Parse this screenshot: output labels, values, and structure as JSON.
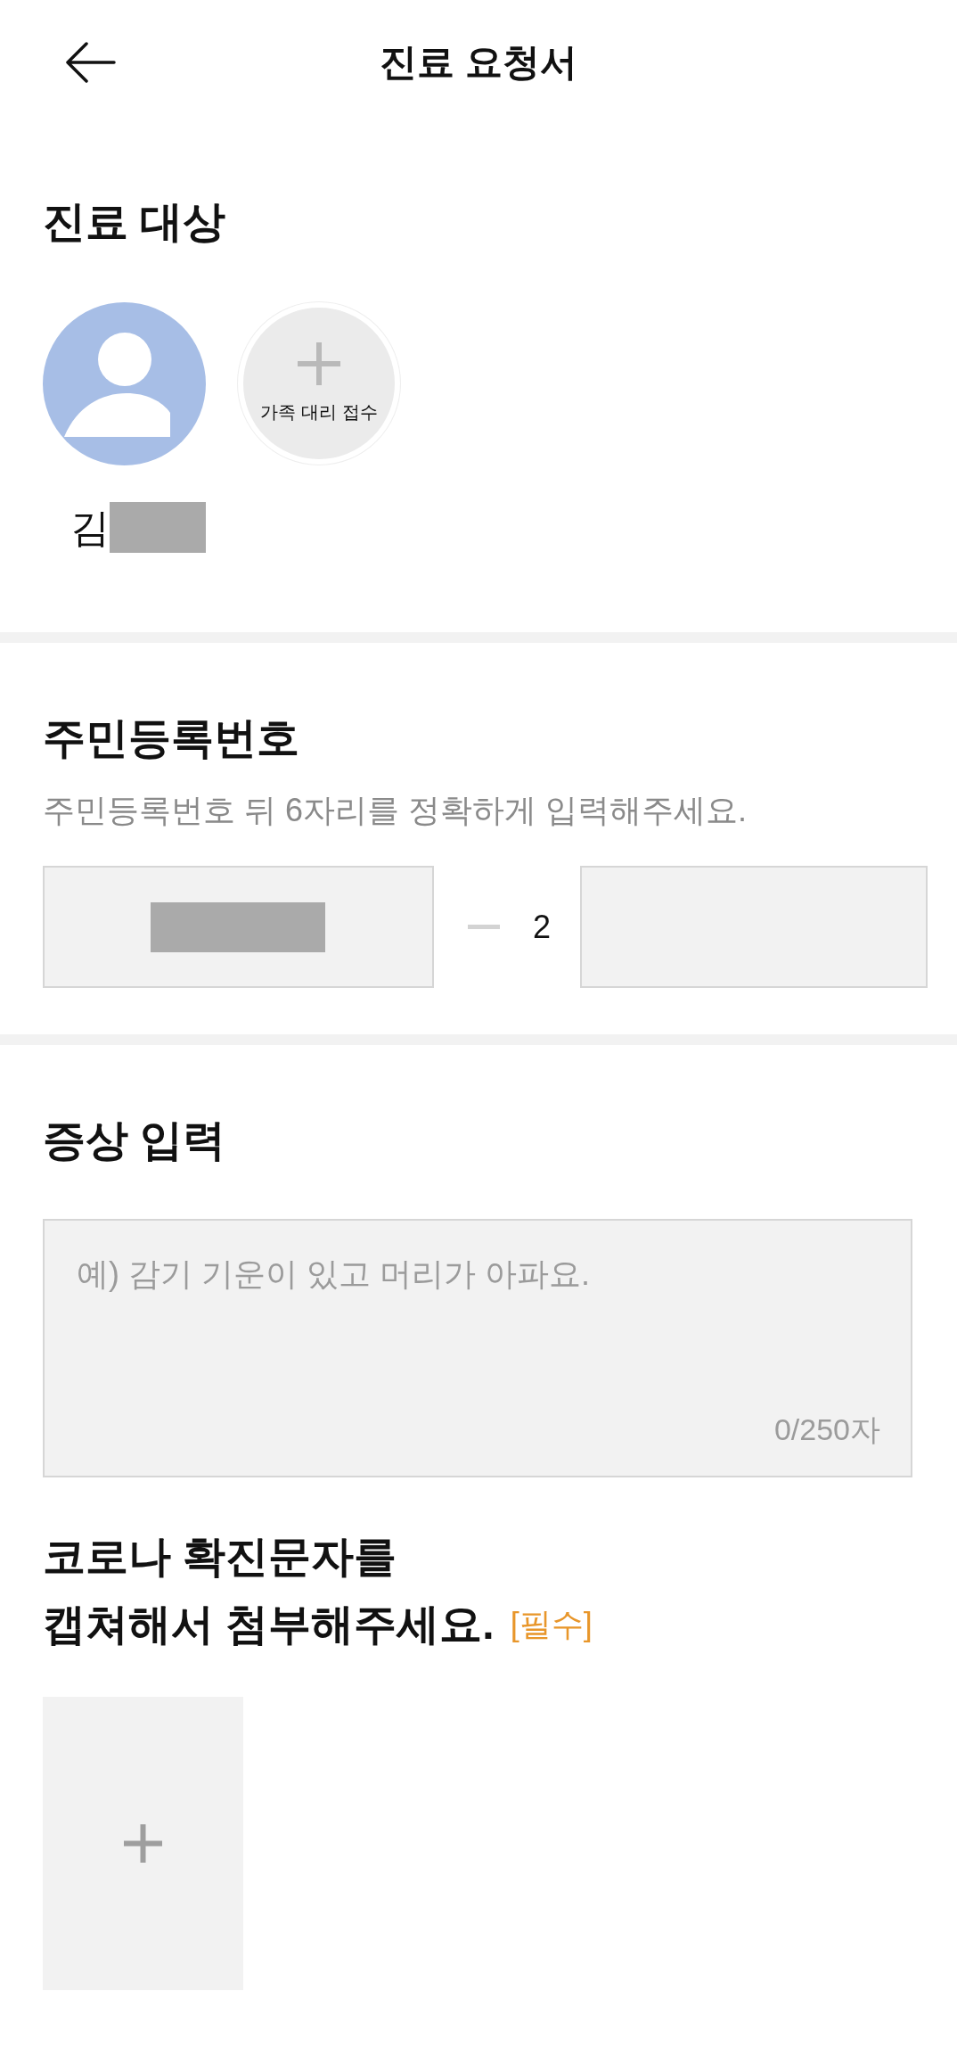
{
  "header": {
    "title": "진료 요청서"
  },
  "patient_section": {
    "title": "진료 대상",
    "patients": [
      {
        "name": "김",
        "redacted": true
      }
    ],
    "add_family_button": {
      "label": "가족 대리 접수"
    }
  },
  "resident_number": {
    "title": "주민등록번호",
    "hint": "주민등록번호 뒤 6자리를 정확하게 입력해주세요.",
    "front_field": {
      "redacted": true
    },
    "back_first_digit": "2",
    "back_field": {
      "redacted": false
    }
  },
  "symptoms": {
    "title": "증상 입력",
    "placeholder": "예) 감기 기운이 있고 머리가 아파요.",
    "counter": "0/250자"
  },
  "attachment": {
    "title": "코로나 확진문자를\n캡쳐해서 첨부해주세요.",
    "required_tag": "[필수]"
  }
}
